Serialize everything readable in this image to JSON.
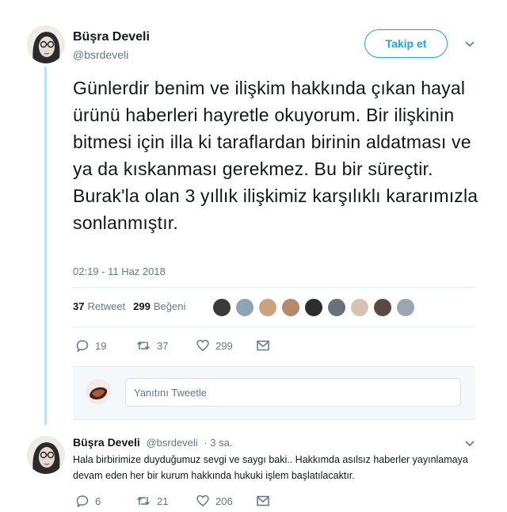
{
  "main_tweet": {
    "author_name": "Büşra Develi",
    "author_handle": "@bsrdeveli",
    "follow_label": "Takip et",
    "text": "Günlerdir benim ve ilişkim hakkında çıkan hayal ürünü haberleri hayretle okuyorum. Bir ilişkinin bitmesi için illa ki taraflardan birinin aldatması ve ya da kıskanması gerekmez. Bu bir süreçtir. Burak'la olan 3 yıllık ilişkimiz karşılıklı kararımızla sonlanmıştır.",
    "timestamp": "02:19 - 11 Haz 2018",
    "retweet_count": "37",
    "retweet_label": "Retweet",
    "like_count": "299",
    "like_label": "Beğeni",
    "actions": {
      "replies": "19",
      "retweets": "37",
      "likes": "299"
    }
  },
  "liker_avatars": [
    "#3a3a3a",
    "#8fa3b5",
    "#c9a37f",
    "#b5896a",
    "#2d2d2d",
    "#6b6f7a",
    "#d7c2b0",
    "#5a4a44",
    "#9aa6b0"
  ],
  "reply_box": {
    "placeholder": "Yanıtını Tweetle"
  },
  "reply_tweet": {
    "author_name": "Büşra Develi",
    "author_handle": "@bsrdeveli",
    "time": "· 3 sa.",
    "text": "Hala birbirimize duyduğumuz sevgi ve saygı baki.. Hakkımda asılsız haberler yayınlamaya devam eden her bir kurum hakkında hukuki işlem başlatılacaktır.",
    "actions": {
      "replies": "6",
      "retweets": "21",
      "likes": "206"
    }
  },
  "colors": {
    "accent": "#1da1f2",
    "thread_line": "#b9e3fa",
    "muted": "#657786"
  },
  "icons": [
    "reply-icon",
    "retweet-icon",
    "heart-icon",
    "mail-icon",
    "chevron-down-icon"
  ]
}
